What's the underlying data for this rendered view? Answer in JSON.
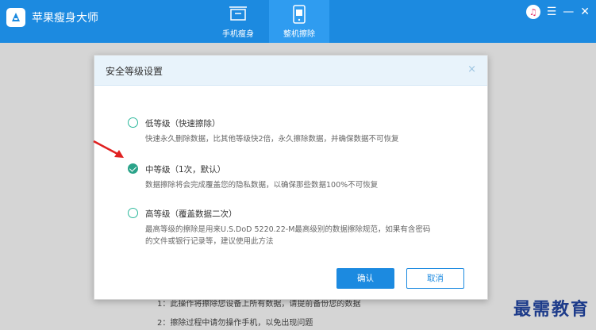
{
  "app": {
    "title": "苹果瘦身大师"
  },
  "tabs": [
    {
      "label": "手机瘦身",
      "icon": "phone-slim-icon"
    },
    {
      "label": "整机擦除",
      "icon": "phone-erase-icon"
    }
  ],
  "window_controls": [
    "music-icon",
    "menu-icon",
    "minimize-icon",
    "close-icon"
  ],
  "background_notes": [
    "1：此操作将擦除您设备上所有数据，请提前备份您的数据",
    "2：擦除过程中请勿操作手机，以免出现问题"
  ],
  "modal": {
    "title": "安全等级设置",
    "close_glyph": "×",
    "options": [
      {
        "title": "低等级（快速擦除）",
        "desc": "快速永久删除数据，比其他等级快2倍，永久擦除数据，并确保数据不可恢复",
        "checked": false
      },
      {
        "title": "中等级（1次，默认）",
        "desc": "数据擦除将会完成覆盖您的隐私数据，以确保那些数据100%不可恢复",
        "checked": true
      },
      {
        "title": "高等级（覆盖数据二次）",
        "desc_line1": "最高等级的擦除是用来U.S.DoD 5220.22-M最高级别的数据擦除规范，如果有含密码",
        "desc_line2": "的文件或银行记录等，建议使用此方法",
        "checked": false
      }
    ],
    "confirm_label": "确认",
    "cancel_label": "取消"
  },
  "watermark": "最需教育",
  "colors": {
    "primary": "#1c8ae0",
    "tab_active": "#2f9cf0",
    "radio": "#2aa389",
    "arrow": "#e02020"
  }
}
